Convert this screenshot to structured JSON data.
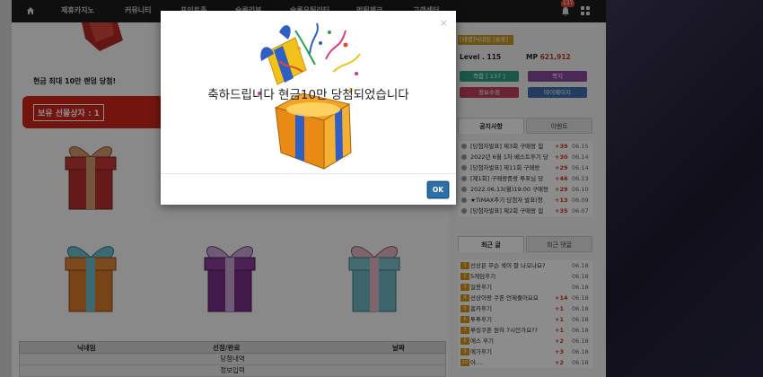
{
  "nav": {
    "items": [
      "제휴카지노",
      "커뮤니티",
      "포인트존",
      "슬롯리뷰",
      "슬롯유틸리티",
      "먹튀체크",
      "고객센터"
    ],
    "badge": "137"
  },
  "promo": {
    "text": "현금 최대 10만 랜덤 당첨!",
    "box_label": "보유 선물상자 : 1"
  },
  "table": {
    "headers": [
      "닉네임",
      "선정/판료",
      "날짜"
    ],
    "rows": [
      "당첨내역",
      "정보입력"
    ]
  },
  "user": {
    "name": "[레벨]닉네임 [슬롯]",
    "level": "Level . 115",
    "mp_label": "MP",
    "mp_value": "621,912",
    "buttons": [
      {
        "label": "쪽함 [ 137 ]",
        "color": "#2f9e86"
      },
      {
        "label": "쪽지",
        "color": "#8a4a9e"
      },
      {
        "label": "정보수정",
        "color": "#c2415b"
      },
      {
        "label": "마이페이지",
        "color": "#3c6fae"
      }
    ]
  },
  "notice": {
    "tabs": [
      "공지사항",
      "이벤트"
    ],
    "items": [
      {
        "title": "[당첨자발표] 제3회 구매왕 힘",
        "count": "+39",
        "date": "06.15"
      },
      {
        "title": "2022년 6월 1차 베스트후기 당",
        "count": "+30",
        "date": "06.14"
      },
      {
        "title": "[당첨자발표] 제11회 구매왕",
        "count": "+29",
        "date": "06.14"
      },
      {
        "title": "[제1회] 구매왕중왕 투표님 당",
        "count": "+46",
        "date": "06.13"
      },
      {
        "title": "2022.06.13(월)19:00 구매왕",
        "count": "+29",
        "date": "06.10"
      },
      {
        "title": "★TIMAX추기 당첨자 발표(청",
        "count": "+13",
        "date": "06.09"
      },
      {
        "title": "[당첨자발표] 제2회 구매왕 힘",
        "count": "+35",
        "date": "06.07"
      }
    ]
  },
  "recent": {
    "tabs": [
      "최근 글",
      "최근 댓글"
    ],
    "items": [
      {
        "num": "1",
        "title": "선상은 무슨 색이 잘 나오나요?",
        "count": "",
        "date": "06.18"
      },
      {
        "num": "2",
        "title": "5게임후기",
        "count": "",
        "date": "06.18"
      },
      {
        "num": "3",
        "title": "일용후기",
        "count": "",
        "date": "06.18"
      },
      {
        "num": "4",
        "title": "선상이랑 쿠폰 언제풀어요요",
        "count": "+14",
        "date": "06.18"
      },
      {
        "num": "5",
        "title": "홈카후기",
        "count": "+1",
        "date": "06.18"
      },
      {
        "num": "6",
        "title": "투투후기",
        "count": "+1",
        "date": "06.18"
      },
      {
        "num": "7",
        "title": "루징쿠폰 원하 7시인가요??",
        "count": "+1",
        "date": "06.18"
      },
      {
        "num": "8",
        "title": "에스 후기",
        "count": "+2",
        "date": "06.18"
      },
      {
        "num": "9",
        "title": "에가후기",
        "count": "+3",
        "date": "06.18"
      },
      {
        "num": "10",
        "title": "아....",
        "count": "+2",
        "date": "06.18"
      }
    ]
  },
  "modal": {
    "message": "축하드립니다 현금10만 당첨되었습니다",
    "close": "×",
    "ok": "OK"
  },
  "icons": {
    "home": "home-icon",
    "bell": "bell-icon",
    "grid": "grid-icon",
    "close": "close-icon"
  }
}
